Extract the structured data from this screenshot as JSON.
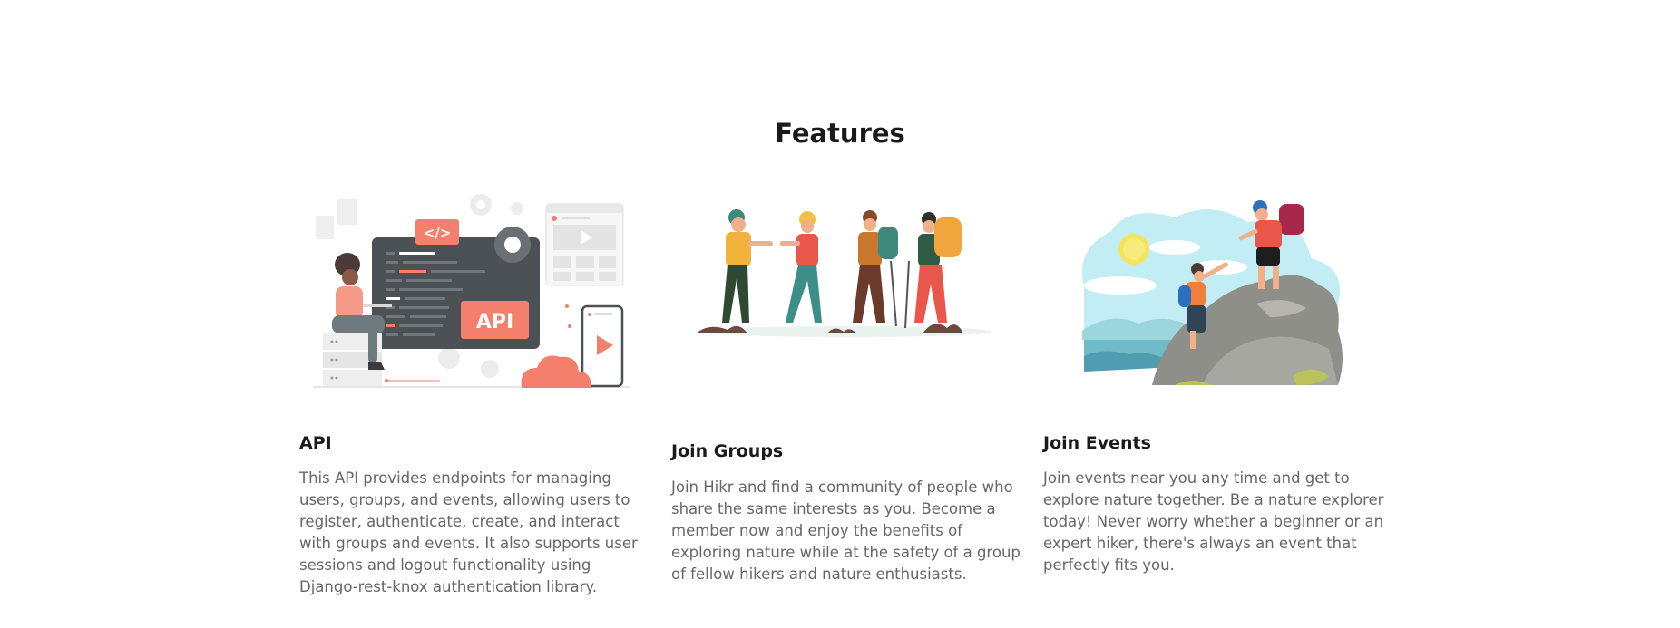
{
  "section": {
    "title": "Features"
  },
  "features": [
    {
      "title": "API",
      "description": "This API provides endpoints for managing users, groups, and events, allowing users to register, authenticate, create, and interact with groups and events. It also supports user sessions and logout functionality using Django-rest-knox authentication library.",
      "illustration": "developer-api-illustration",
      "badge_label": "API",
      "code_tag": "</>"
    },
    {
      "title": "Join Groups",
      "description": "Join Hikr and find a community of people who share the same interests as you. Become a member now and enjoy the benefits of exploring nature while at the safety of a group of fellow hikers and nature enthusiasts.",
      "illustration": "hikers-group-illustration"
    },
    {
      "title": "Join Events",
      "description": "Join events near you any time and get to explore nature together. Be a nature explorer today! Never worry whether a beginner or an expert hiker, there's always an event that perfectly fits you.",
      "illustration": "climbers-helping-illustration"
    }
  ],
  "colors": {
    "accent": "#f37f6c",
    "dark_panel": "#4b5155",
    "sky": "#c3edf5",
    "rock": "#8f8f8a"
  }
}
